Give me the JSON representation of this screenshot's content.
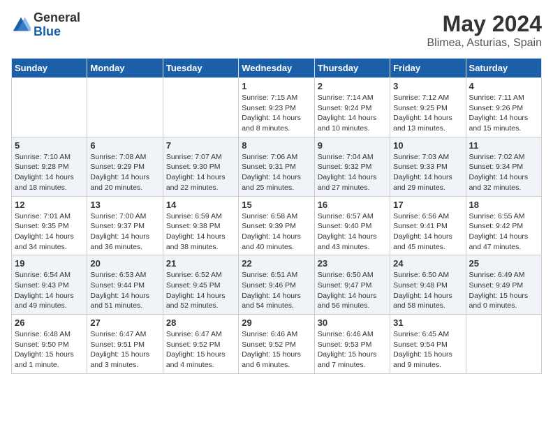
{
  "header": {
    "logo_general": "General",
    "logo_blue": "Blue",
    "month": "May 2024",
    "location": "Blimea, Asturias, Spain"
  },
  "weekdays": [
    "Sunday",
    "Monday",
    "Tuesday",
    "Wednesday",
    "Thursday",
    "Friday",
    "Saturday"
  ],
  "weeks": [
    [
      {
        "day": "",
        "info": ""
      },
      {
        "day": "",
        "info": ""
      },
      {
        "day": "",
        "info": ""
      },
      {
        "day": "1",
        "info": "Sunrise: 7:15 AM\nSunset: 9:23 PM\nDaylight: 14 hours\nand 8 minutes."
      },
      {
        "day": "2",
        "info": "Sunrise: 7:14 AM\nSunset: 9:24 PM\nDaylight: 14 hours\nand 10 minutes."
      },
      {
        "day": "3",
        "info": "Sunrise: 7:12 AM\nSunset: 9:25 PM\nDaylight: 14 hours\nand 13 minutes."
      },
      {
        "day": "4",
        "info": "Sunrise: 7:11 AM\nSunset: 9:26 PM\nDaylight: 14 hours\nand 15 minutes."
      }
    ],
    [
      {
        "day": "5",
        "info": "Sunrise: 7:10 AM\nSunset: 9:28 PM\nDaylight: 14 hours\nand 18 minutes."
      },
      {
        "day": "6",
        "info": "Sunrise: 7:08 AM\nSunset: 9:29 PM\nDaylight: 14 hours\nand 20 minutes."
      },
      {
        "day": "7",
        "info": "Sunrise: 7:07 AM\nSunset: 9:30 PM\nDaylight: 14 hours\nand 22 minutes."
      },
      {
        "day": "8",
        "info": "Sunrise: 7:06 AM\nSunset: 9:31 PM\nDaylight: 14 hours\nand 25 minutes."
      },
      {
        "day": "9",
        "info": "Sunrise: 7:04 AM\nSunset: 9:32 PM\nDaylight: 14 hours\nand 27 minutes."
      },
      {
        "day": "10",
        "info": "Sunrise: 7:03 AM\nSunset: 9:33 PM\nDaylight: 14 hours\nand 29 minutes."
      },
      {
        "day": "11",
        "info": "Sunrise: 7:02 AM\nSunset: 9:34 PM\nDaylight: 14 hours\nand 32 minutes."
      }
    ],
    [
      {
        "day": "12",
        "info": "Sunrise: 7:01 AM\nSunset: 9:35 PM\nDaylight: 14 hours\nand 34 minutes."
      },
      {
        "day": "13",
        "info": "Sunrise: 7:00 AM\nSunset: 9:37 PM\nDaylight: 14 hours\nand 36 minutes."
      },
      {
        "day": "14",
        "info": "Sunrise: 6:59 AM\nSunset: 9:38 PM\nDaylight: 14 hours\nand 38 minutes."
      },
      {
        "day": "15",
        "info": "Sunrise: 6:58 AM\nSunset: 9:39 PM\nDaylight: 14 hours\nand 40 minutes."
      },
      {
        "day": "16",
        "info": "Sunrise: 6:57 AM\nSunset: 9:40 PM\nDaylight: 14 hours\nand 43 minutes."
      },
      {
        "day": "17",
        "info": "Sunrise: 6:56 AM\nSunset: 9:41 PM\nDaylight: 14 hours\nand 45 minutes."
      },
      {
        "day": "18",
        "info": "Sunrise: 6:55 AM\nSunset: 9:42 PM\nDaylight: 14 hours\nand 47 minutes."
      }
    ],
    [
      {
        "day": "19",
        "info": "Sunrise: 6:54 AM\nSunset: 9:43 PM\nDaylight: 14 hours\nand 49 minutes."
      },
      {
        "day": "20",
        "info": "Sunrise: 6:53 AM\nSunset: 9:44 PM\nDaylight: 14 hours\nand 51 minutes."
      },
      {
        "day": "21",
        "info": "Sunrise: 6:52 AM\nSunset: 9:45 PM\nDaylight: 14 hours\nand 52 minutes."
      },
      {
        "day": "22",
        "info": "Sunrise: 6:51 AM\nSunset: 9:46 PM\nDaylight: 14 hours\nand 54 minutes."
      },
      {
        "day": "23",
        "info": "Sunrise: 6:50 AM\nSunset: 9:47 PM\nDaylight: 14 hours\nand 56 minutes."
      },
      {
        "day": "24",
        "info": "Sunrise: 6:50 AM\nSunset: 9:48 PM\nDaylight: 14 hours\nand 58 minutes."
      },
      {
        "day": "25",
        "info": "Sunrise: 6:49 AM\nSunset: 9:49 PM\nDaylight: 15 hours\nand 0 minutes."
      }
    ],
    [
      {
        "day": "26",
        "info": "Sunrise: 6:48 AM\nSunset: 9:50 PM\nDaylight: 15 hours\nand 1 minute."
      },
      {
        "day": "27",
        "info": "Sunrise: 6:47 AM\nSunset: 9:51 PM\nDaylight: 15 hours\nand 3 minutes."
      },
      {
        "day": "28",
        "info": "Sunrise: 6:47 AM\nSunset: 9:52 PM\nDaylight: 15 hours\nand 4 minutes."
      },
      {
        "day": "29",
        "info": "Sunrise: 6:46 AM\nSunset: 9:52 PM\nDaylight: 15 hours\nand 6 minutes."
      },
      {
        "day": "30",
        "info": "Sunrise: 6:46 AM\nSunset: 9:53 PM\nDaylight: 15 hours\nand 7 minutes."
      },
      {
        "day": "31",
        "info": "Sunrise: 6:45 AM\nSunset: 9:54 PM\nDaylight: 15 hours\nand 9 minutes."
      },
      {
        "day": "",
        "info": ""
      }
    ]
  ]
}
